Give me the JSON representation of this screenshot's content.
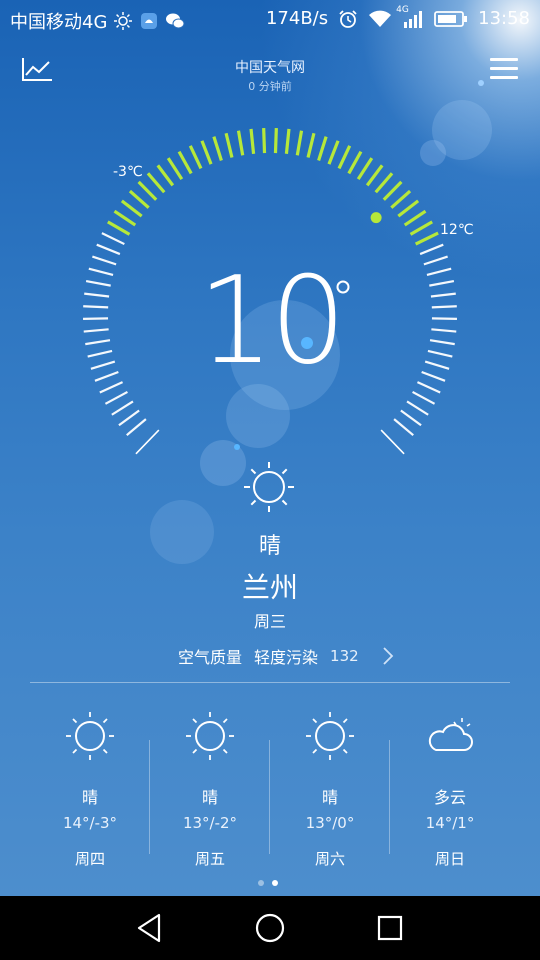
{
  "status_bar": {
    "carrier": "中国移动4G",
    "speed": "174B/s",
    "network_badge": "4G",
    "time": "13:58",
    "icons": [
      "sun-icon",
      "app-notification-icon",
      "wechat-icon",
      "alarm-icon",
      "wifi-icon",
      "signal-icon",
      "battery-icon"
    ]
  },
  "header": {
    "source": "中国天气网",
    "updated": "0 分钟前",
    "chart_icon": "trend-chart-icon",
    "menu_icon": "menu-icon"
  },
  "current": {
    "temperature": "10",
    "unit": "°",
    "low_label": "-3℃",
    "high_label": "12℃",
    "range_low": -3,
    "range_high": 12,
    "current_value": 10,
    "condition": "晴",
    "condition_icon": "sun-icon",
    "city": "兰州",
    "weekday": "周三",
    "aqi_label": "空气质量",
    "aqi_level": "轻度污染",
    "aqi_value": "132",
    "accent_color": "#b6e83a"
  },
  "forecast": [
    {
      "icon": "sun-icon",
      "condition": "晴",
      "range": "14°/-3°",
      "day": "周四"
    },
    {
      "icon": "sun-icon",
      "condition": "晴",
      "range": "13°/-2°",
      "day": "周五"
    },
    {
      "icon": "sun-icon",
      "condition": "晴",
      "range": "13°/0°",
      "day": "周六"
    },
    {
      "icon": "cloud-icon",
      "condition": "多云",
      "range": "14°/1°",
      "day": "周日"
    }
  ],
  "pager": {
    "pages": 2,
    "active": 2
  },
  "nav": [
    "back-icon",
    "home-icon",
    "recents-icon"
  ]
}
